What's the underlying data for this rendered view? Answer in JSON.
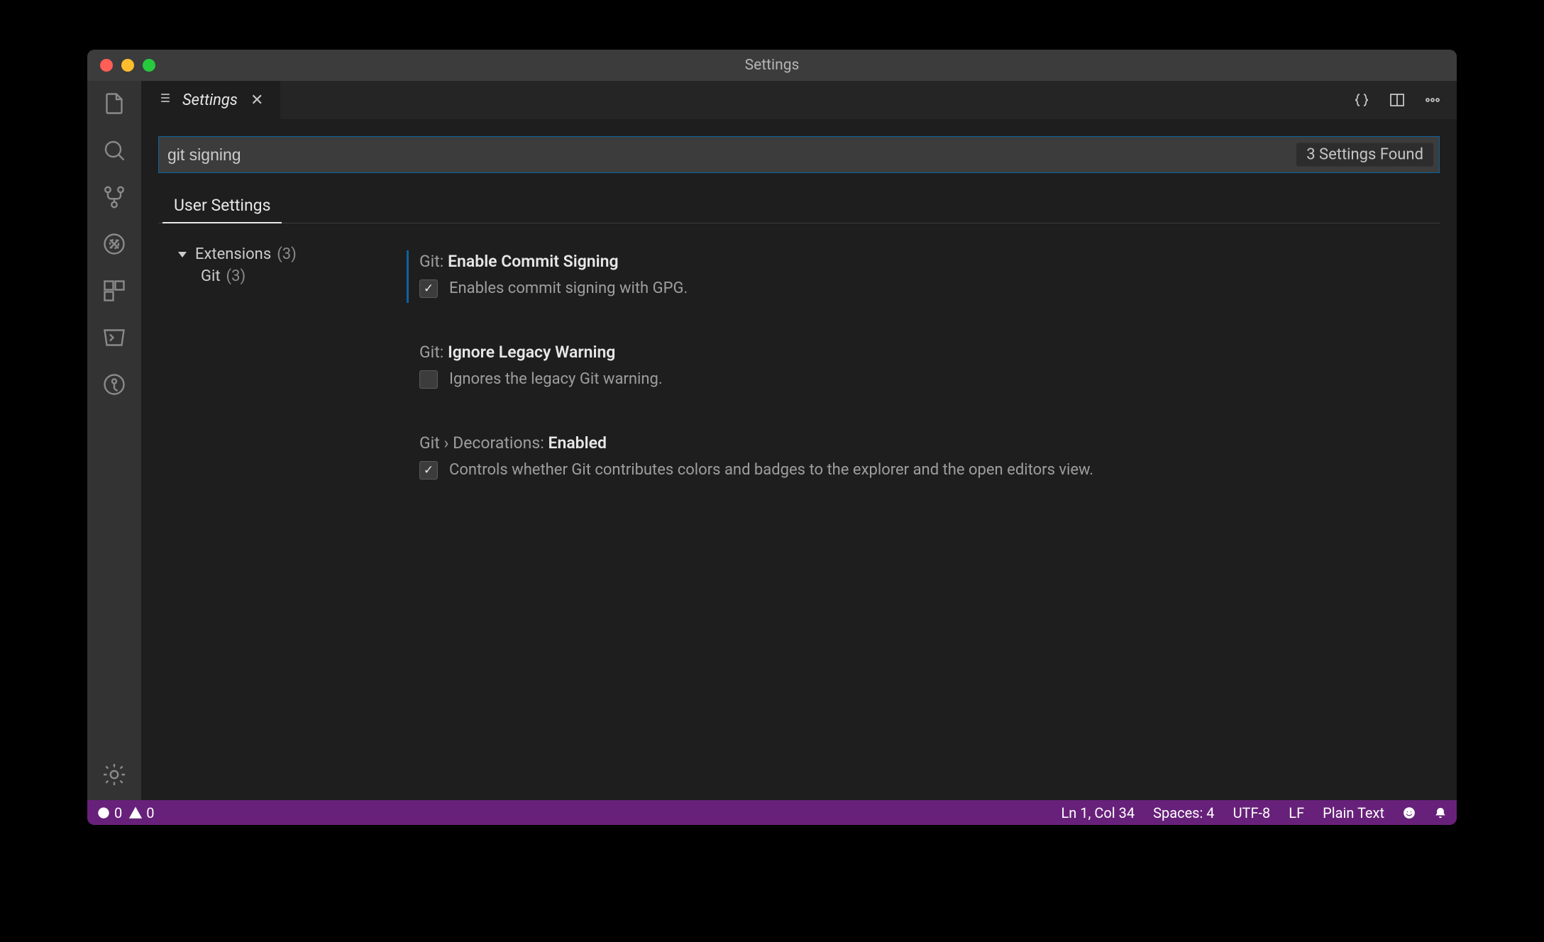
{
  "window": {
    "title": "Settings"
  },
  "tab": {
    "label": "Settings"
  },
  "search": {
    "value": "git signing",
    "results_label": "3 Settings Found"
  },
  "scope_tab": "User Settings",
  "toc": {
    "root_label": "Extensions",
    "root_count": "(3)",
    "child_label": "Git",
    "child_count": "(3)"
  },
  "settings": [
    {
      "scope": "Git:",
      "key": "Enable Commit Signing",
      "checked": true,
      "modified": true,
      "description": "Enables commit signing with GPG."
    },
    {
      "scope": "Git:",
      "key": "Ignore Legacy Warning",
      "checked": false,
      "modified": false,
      "description": "Ignores the legacy Git warning."
    },
    {
      "scope": "Git › Decorations:",
      "key": "Enabled",
      "checked": true,
      "modified": false,
      "description": "Controls whether Git contributes colors and badges to the explorer and the open editors view."
    }
  ],
  "status": {
    "errors": "0",
    "warnings": "0",
    "cursor": "Ln 1, Col 34",
    "spaces": "Spaces: 4",
    "encoding": "UTF-8",
    "eol": "LF",
    "language": "Plain Text"
  }
}
